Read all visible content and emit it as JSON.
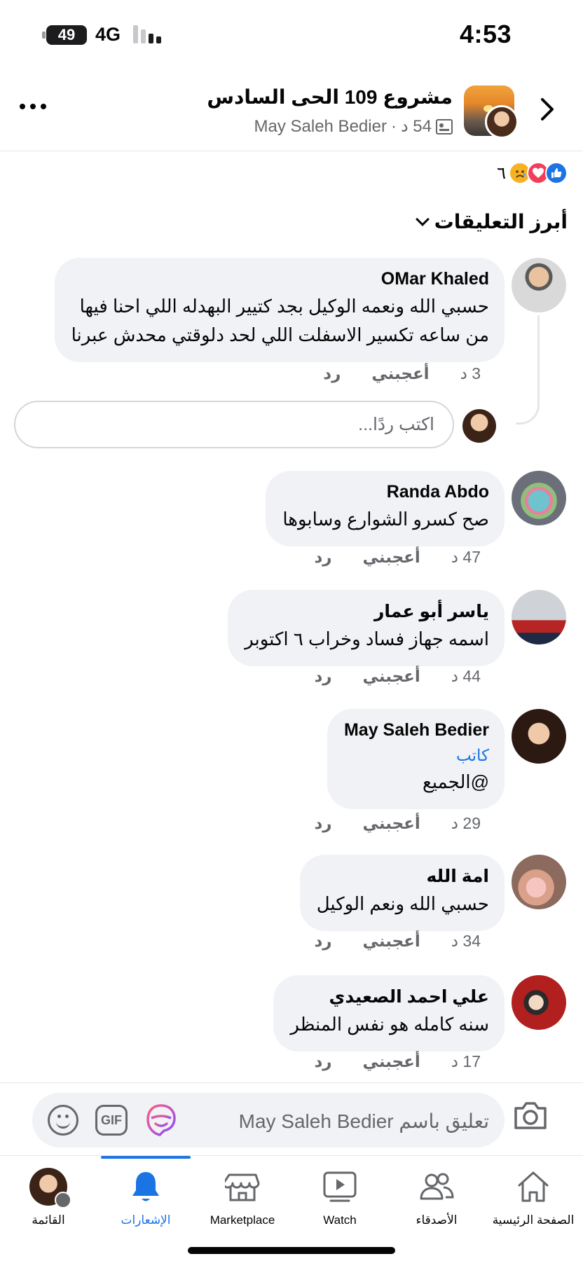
{
  "status_bar": {
    "time": "4:53",
    "battery": "49",
    "network": "4G"
  },
  "header": {
    "group_name": "مشروع 109 الحى السادس",
    "author": "May Saleh Bedier",
    "meta_time": "54 د",
    "separator": "·"
  },
  "reactions": {
    "count": "٦",
    "types": [
      "like",
      "love",
      "sad"
    ]
  },
  "sort": {
    "label": "أبرز التعليقات"
  },
  "actions": {
    "like": "أعجبني",
    "reply": "رد"
  },
  "comments": [
    {
      "name": "OMar Khaled",
      "lines": [
        "حسبي الله ونعمه الوكيل بجد كتيير البهدله اللي احنا فيها",
        "من ساعه تكسير الاسفلت اللي لحد دلوقتي محدش عبرنا"
      ],
      "time": "3 د"
    },
    {
      "name": "Randa Abdo",
      "lines": [
        "صح كسرو الشوارع وسابوها"
      ],
      "time": "47 د"
    },
    {
      "name": "ياسر أبو عمار",
      "lines": [
        "اسمه جهاز فساد وخراب ٦ اكتوبر"
      ],
      "time": "44 د"
    },
    {
      "name": "May Saleh Bedier",
      "badge": "كاتب",
      "lines": [
        "@الجميع"
      ],
      "time": "29 د"
    },
    {
      "name": "امة الله",
      "lines": [
        "حسبي الله ونعم الوكيل"
      ],
      "time": "34 د"
    },
    {
      "name": "علي احمد الصعيدي",
      "lines": [
        "سنه كامله هو نفس المنظر"
      ],
      "time": "17 د"
    }
  ],
  "reply_box": {
    "placeholder": "اكتب ردًا..."
  },
  "composer": {
    "placeholder": "تعليق باسم May Saleh Bedier",
    "gif_label": "GIF"
  },
  "bottom_nav": {
    "menu": "القائمة",
    "notifications": "الإشعارات",
    "marketplace": "Marketplace",
    "watch": "Watch",
    "friends": "الأصدقاء",
    "home": "الصفحة الرئيسية"
  },
  "colors": {
    "accent": "#1b74e4",
    "bubble": "#f0f2f5",
    "secondary_text": "#65676b"
  }
}
